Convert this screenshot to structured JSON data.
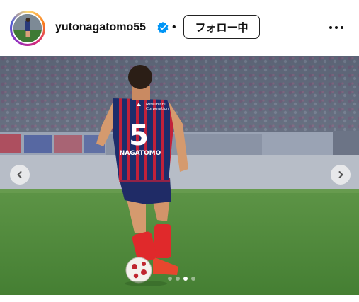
{
  "header": {
    "username": "yutonagatomo55",
    "verified": true,
    "separator": "•",
    "follow_label": "フォロー中",
    "more_icon": "more-horizontal-icon"
  },
  "photo": {
    "jersey_number": "5",
    "jersey_name": "NAGATOMO",
    "sponsor_line1": "Mitsubishi",
    "sponsor_line2": "Corporation"
  },
  "carousel": {
    "total": 4,
    "active_index": 2,
    "prev_icon": "chevron-left-icon",
    "next_icon": "chevron-right-icon"
  },
  "colors": {
    "verified": "#0095f6",
    "jersey_blue": "#1d2d6b",
    "jersey_red": "#c2213a",
    "pitch": "#4e8a3a"
  }
}
